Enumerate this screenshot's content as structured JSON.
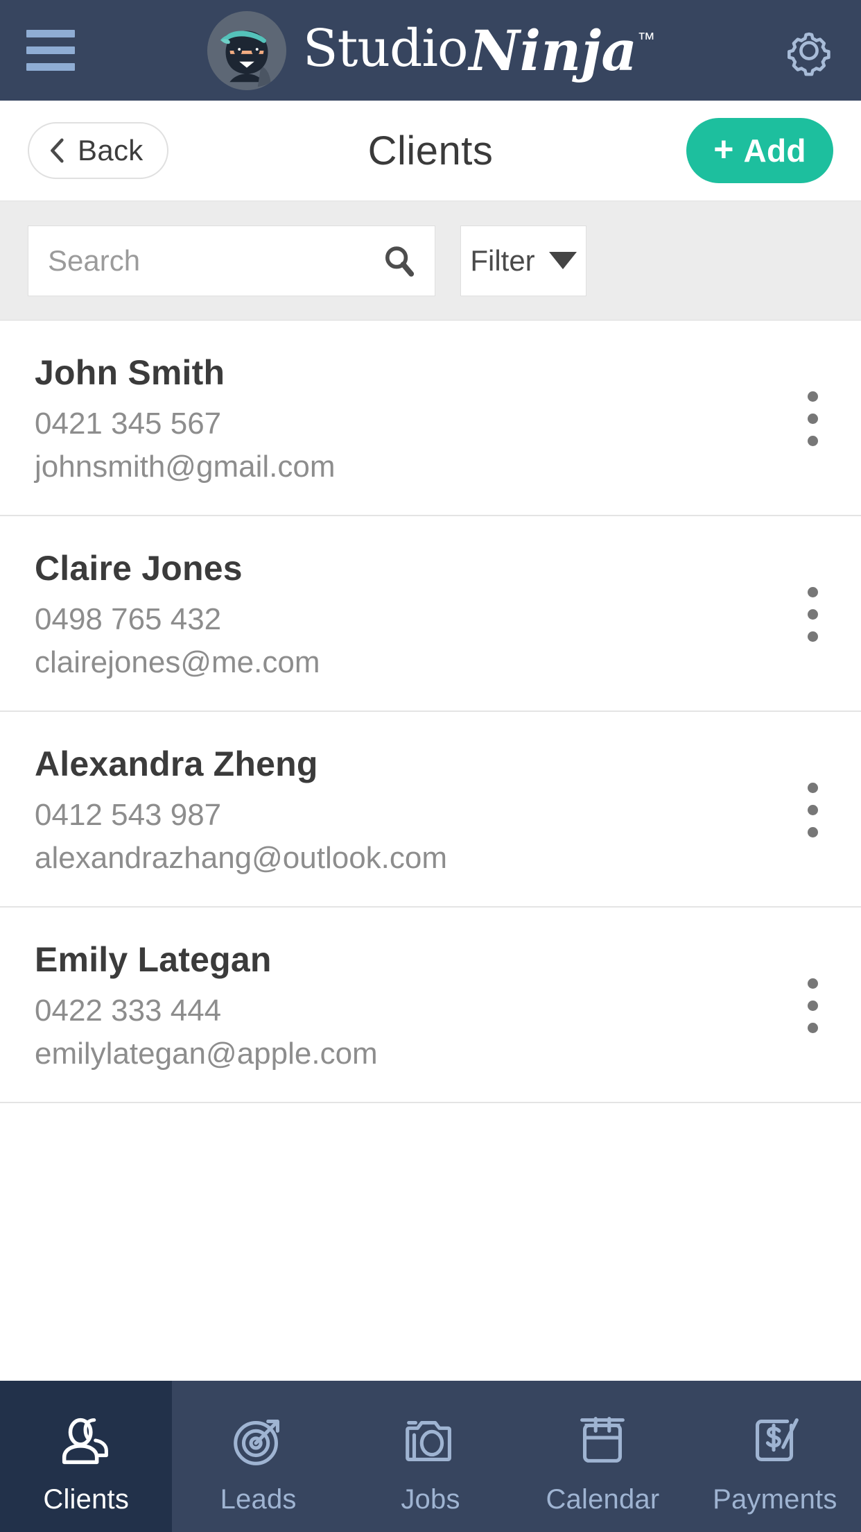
{
  "header": {
    "menu_icon": "hamburger-menu-icon",
    "logo_icon": "studio-ninja-logo-icon",
    "brand_primary": "Studio",
    "brand_secondary": "Ninja",
    "brand_tm": "™",
    "settings_icon": "gear-icon",
    "background_color": "#37455f",
    "icon_color": "#8fadd4"
  },
  "navbar": {
    "back_label": "Back",
    "back_icon": "chevron-left-icon",
    "title": "Clients",
    "add_label": "Add",
    "add_plus": "+",
    "add_color": "#1dbf9e"
  },
  "search": {
    "placeholder": "Search",
    "value": "",
    "search_icon": "search-icon",
    "filter_label": "Filter",
    "filter_caret_icon": "chevron-down-icon",
    "background_color": "#ececec"
  },
  "clients": [
    {
      "name": "John Smith",
      "phone": "0421 345 567",
      "email": "johnsmith@gmail.com",
      "menu_icon": "kebab-menu-icon"
    },
    {
      "name": "Claire Jones",
      "phone": "0498 765 432",
      "email": "clairejones@me.com",
      "menu_icon": "kebab-menu-icon"
    },
    {
      "name": "Alexandra Zheng",
      "phone": "0412 543 987",
      "email": "alexandrazhang@outlook.com",
      "menu_icon": "kebab-menu-icon"
    },
    {
      "name": "Emily Lategan",
      "phone": "0422 333 444",
      "email": "emilylategan@apple.com",
      "menu_icon": "kebab-menu-icon"
    }
  ],
  "tabs": [
    {
      "label": "Clients",
      "icon": "users-icon",
      "active": true
    },
    {
      "label": "Leads",
      "icon": "target-icon",
      "active": false
    },
    {
      "label": "Jobs",
      "icon": "camera-icon",
      "active": false
    },
    {
      "label": "Calendar",
      "icon": "calendar-icon",
      "active": false
    },
    {
      "label": "Payments",
      "icon": "money-note-icon",
      "active": false
    }
  ],
  "tabbar": {
    "background_color": "#37455f",
    "active_background_color": "#22314a",
    "inactive_color": "#9fb4d2",
    "active_color": "#ffffff"
  }
}
